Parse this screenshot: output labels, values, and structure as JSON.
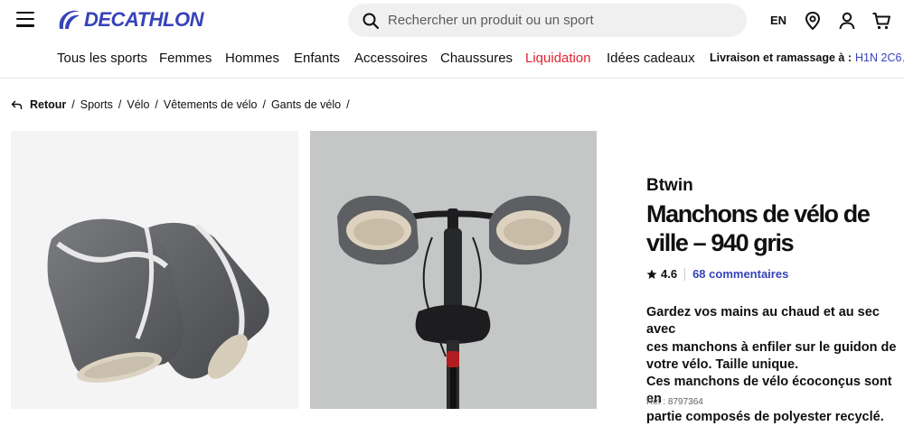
{
  "header": {
    "logo_text": "DECATHLON",
    "search_placeholder": "Rechercher un produit ou un sport",
    "lang": "EN",
    "icons": [
      "menu-icon",
      "search-icon",
      "store-locator-icon",
      "account-icon",
      "cart-icon"
    ],
    "brand_color": "#3643ba"
  },
  "nav": {
    "items": [
      "Tous les sports",
      "Femmes",
      "Hommes",
      "Enfants",
      "Accessoires",
      "Chaussures",
      "Liquidation",
      "Idées cadeaux"
    ],
    "sale_color": "#e3262f",
    "delivery_label": "Livraison et ramassage à :",
    "postal_code": "H1N 2C6"
  },
  "breadcrumb": {
    "back": "Retour",
    "items": [
      "Sports",
      "Vélo",
      "Vêtements de vélo",
      "Gants de vélo"
    ]
  },
  "product": {
    "brand": "Btwin",
    "title": "Manchons de vélo de ville – 940 gris",
    "rating": "4.6",
    "reviews": "68 commentaires",
    "description_lines": [
      "Gardez vos mains au chaud et au sec avec",
      "ces manchons à enfiler sur le guidon de",
      "votre vélo. Taille unique.",
      "Ces manchons de vélo écoconçus sont en",
      "partie composés de polyester recyclé."
    ],
    "ref": "Réf : 8797364"
  }
}
